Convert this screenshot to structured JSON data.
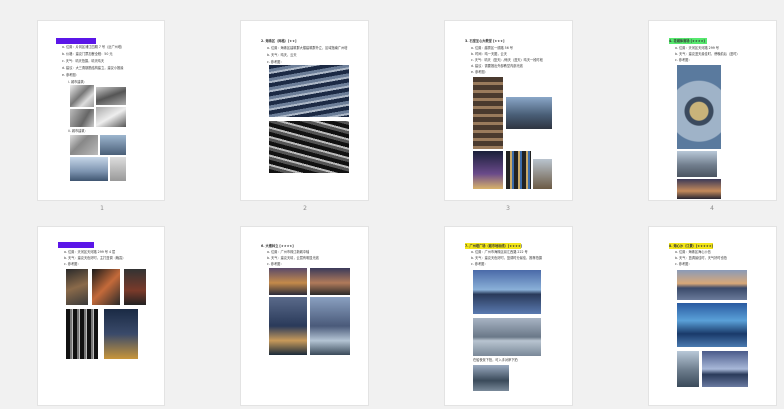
{
  "pages": [
    {
      "number": "1",
      "title": "",
      "highlight": "#5b16e8",
      "lines": [
        "a. 位置：片冈区浦江四期 7 号（近广州塔）",
        "b. 价格：建议门票加餐全程：50 元",
        "c. 天气：晴天拍摄，晴天晴天",
        "d. 建议：大三角钢筋结构建立，建议小推最",
        "e. 参考图："
      ],
      "sublabels": [
        "i. 城市建筑：",
        "ii. 城市建筑："
      ]
    },
    {
      "number": "2",
      "title": "2. 海珠区（网格）[★★]",
      "highlight": "",
      "lines": [
        "a. 位置：海珠区建筑群大楼建筑群外立，区域指南广州塔",
        "b. 天气：晴天，云天",
        "c. 参考图："
      ],
      "sublabels": []
    },
    {
      "number": "3",
      "title": "3. 石室圣心大教堂 [★★★]",
      "highlight": "",
      "lines": [
        "a. 位置：越秀区一德路 56 号",
        "b. 时间：晴一天图，云天",
        "c. 天气：晴天（蓝天）/雨天（蓝天）晴天一段时段",
        "d. 建议：需要推出外部教堂内部光线",
        "e. 参考图："
      ],
      "sublabels": []
    },
    {
      "number": "4",
      "title": "4. 花城体育场 [★★★★]",
      "highlight": "#56e86e",
      "lines": [
        "a. 位置：天河区天河路 299 号",
        "b. 天气：建议蓝天最佳时，傍晚前后（蓝时）",
        "c. 参考图："
      ],
      "sublabels": []
    },
    {
      "number": "",
      "title": "",
      "highlight": "#5b16e8",
      "lines": [
        "a. 位置：天河区天河路 299 号 4 层",
        "b. 天气：建议天色好时，主打蓝调（晚霞）",
        "c. 参考图："
      ],
      "sublabels": []
    },
    {
      "number": "",
      "title": "6. 大楼林立 [★★★★]",
      "highlight": "",
      "lines": [
        "a. 位置：广州市珠江新城中轴",
        "b. 天气：建议天晴，云层有明显光线",
        "c. 参考图："
      ],
      "sublabels": []
    },
    {
      "number": "",
      "title": "7. 广州塔广场（城市地标线）[★★★★]",
      "highlight": "#f3e619",
      "lines": [
        "a. 位置：广州市海珠区阅江西路 222 号",
        "b. 天气：建议天色好时，蓝调时分最佳，推荐拍摄",
        "c. 参考图："
      ],
      "caption": "在船夜景下拍，可入手对岸下拍"
    },
    {
      "number": "",
      "title": "8. 海心沙（江景）[★★★★★]",
      "highlight": "#f3e619",
      "lines": [
        "a. 位置：海珠区海心沙岛",
        "b. 天气：蓝调最佳时，天气好时也拍",
        "c. 参考图："
      ],
      "sublabels": []
    }
  ],
  "colors": {
    "bg": "#f1f1f1",
    "highlight_purple": "#5b16e8",
    "highlight_green": "#56e86e",
    "highlight_yellow": "#f3e619"
  }
}
